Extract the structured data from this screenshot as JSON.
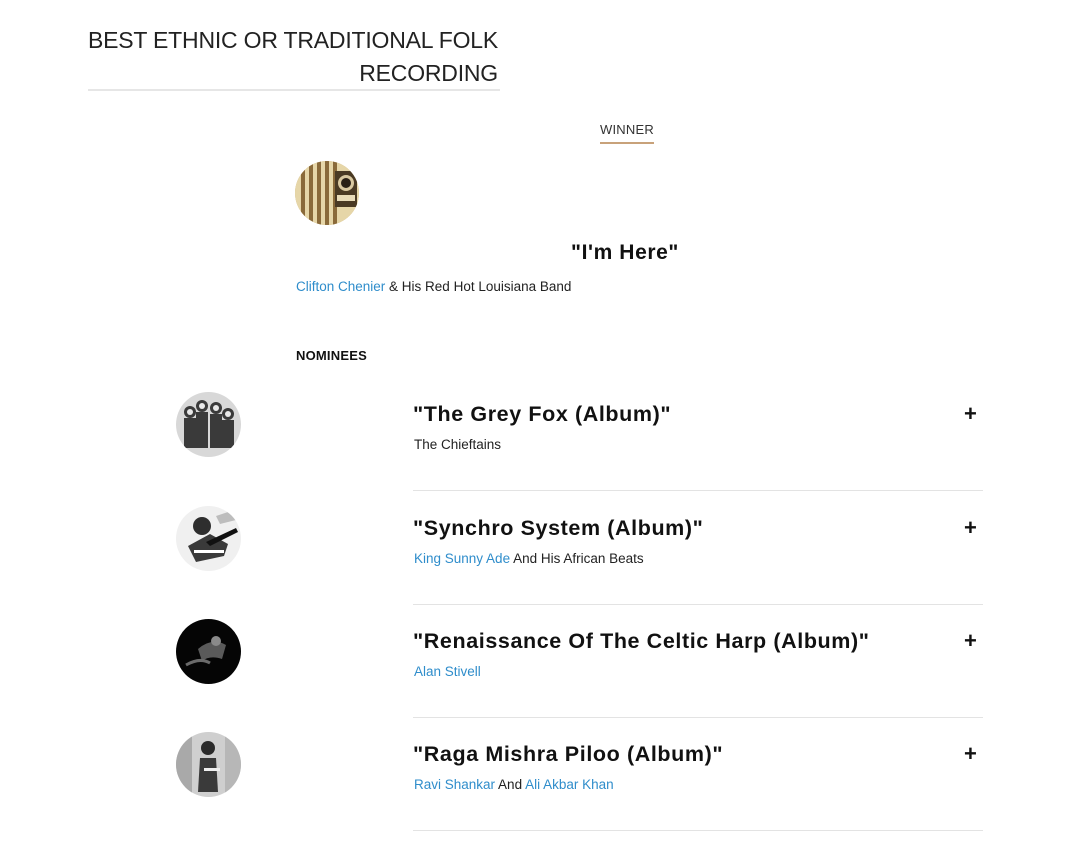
{
  "category": {
    "title_line1": "BEST ETHNIC OR TRADITIONAL FOLK",
    "title_line2": "RECORDING"
  },
  "winner": {
    "label": "WINNER",
    "title": "\"I'm Here\"",
    "credits": [
      {
        "text": "Clifton Chenier",
        "link": true
      },
      {
        "text": " & His Red Hot Louisiana Band",
        "link": false
      }
    ]
  },
  "nominees_label": "NOMINEES",
  "nominees": [
    {
      "title": "\"The Grey Fox (Album)\"",
      "credits": [
        {
          "text": "The Chieftains",
          "link": false
        }
      ],
      "expand": "+"
    },
    {
      "title": "\"Synchro System (Album)\"",
      "credits": [
        {
          "text": "King Sunny Ade",
          "link": true
        },
        {
          "text": " And His African Beats",
          "link": false
        }
      ],
      "expand": "+"
    },
    {
      "title": "\"Renaissance Of The Celtic Harp (Album)\"",
      "credits": [
        {
          "text": "Alan Stivell",
          "link": true
        }
      ],
      "expand": "+"
    },
    {
      "title": "\"Raga Mishra Piloo (Album)\"",
      "credits": [
        {
          "text": "Ravi Shankar",
          "link": true
        },
        {
          "text": " And ",
          "link": false
        },
        {
          "text": "Ali Akbar Khan",
          "link": true
        }
      ],
      "expand": "+"
    }
  ],
  "colors": {
    "link": "#2f8dcb",
    "winner_underline": "#c8a27a",
    "divider": "#e3e3e3"
  }
}
